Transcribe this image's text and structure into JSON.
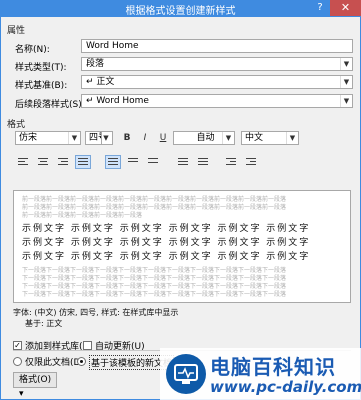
{
  "window": {
    "title": "根据格式设置创建新样式",
    "help": "?",
    "close": "✕"
  },
  "properties": {
    "group_label": "属性",
    "name_label": "名称(N):",
    "name_value": "Word Home",
    "type_label": "样式类型(T):",
    "type_value": "段落",
    "based_label": "样式基准(B):",
    "based_value": "↵ 正文",
    "next_label": "后续段落样式(S):",
    "next_value": "↵ Word Home"
  },
  "format": {
    "group_label": "格式",
    "font": "仿宋",
    "size": "四号",
    "bold": "B",
    "italic": "I",
    "underline": "U",
    "color": "自动",
    "lang": "中文"
  },
  "preview": {
    "prev_text": "前一段落前一段落前一段落前一段落前一段落前一段落前一段落前一段落前一段落前一段落前一段落",
    "sample_text": "示例文字 示例文字 示例文字 示例文字 示例文字 示例文字",
    "next_text": "下一段落下一段落下一段落下一段落下一段落下一段落下一段落下一段落下一段落下一段落下一段落"
  },
  "description": {
    "line1": "字体: (中文) 仿宋, 四号, 样式: 在样式库中显示",
    "line2": "基于: 正文"
  },
  "options": {
    "add_gallery": "添加到样式库(S)",
    "auto_update": "自动更新(U)",
    "only_doc": "仅限此文档(D)",
    "template": "基于该模板的新文档"
  },
  "format_button": "格式(O) ▾",
  "watermark": {
    "title": "电脑百科知识",
    "url": "www.pc-daily.com"
  }
}
